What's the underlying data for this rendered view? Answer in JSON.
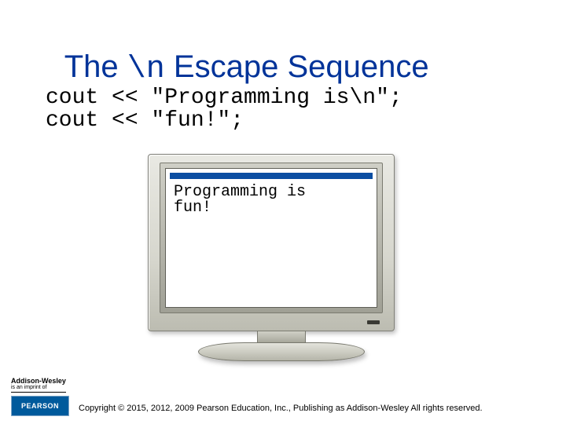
{
  "title": {
    "prefix": "The ",
    "mono": "\\n",
    "suffix": " Escape Sequence"
  },
  "code": "cout << \"Programming is\\n\";\ncout << \"fun!\";",
  "screen_output": "Programming is\nfun!",
  "logos": {
    "aw_name": "Addison-Wesley",
    "aw_tag": "is an imprint of",
    "pearson": "PEARSON"
  },
  "copyright": "Copyright © 2015, 2012, 2009 Pearson Education, Inc., Publishing as Addison-Wesley All rights reserved."
}
